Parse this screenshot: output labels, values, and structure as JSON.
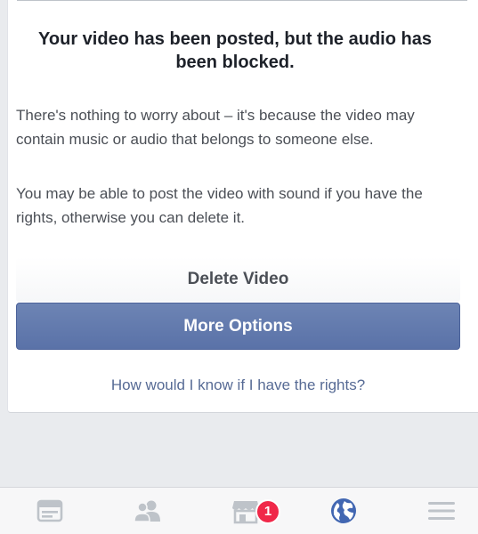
{
  "dialog": {
    "title": "Your video has been posted, but the audio has been blocked.",
    "body_1": "There's nothing to worry about – it's because the video may contain music or audio that belongs to someone else.",
    "body_2": "You may be able to post the video with sound if you have the rights, otherwise you can delete it.",
    "delete_label": "Delete Video",
    "more_options_label": "More Options",
    "rights_link": "How would I know if I have the rights?"
  },
  "tabbar": {
    "tabs": [
      {
        "icon": "news-feed-icon",
        "active": false
      },
      {
        "icon": "friends-icon",
        "active": false
      },
      {
        "icon": "marketplace-icon",
        "active": false
      },
      {
        "icon": "globe-notifications-icon",
        "active": true
      },
      {
        "icon": "menu-icon",
        "active": false
      }
    ],
    "marketplace_badge": "1"
  },
  "colors": {
    "primary_button": "#5b72a9",
    "link": "#576b95",
    "badge": "#f02849",
    "active_tab": "#4267b2",
    "inactive_tab": "#bec3c9"
  }
}
